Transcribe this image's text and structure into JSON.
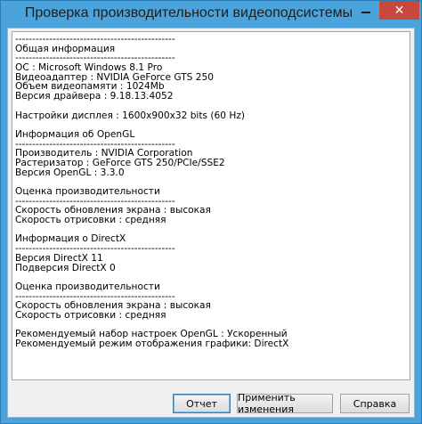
{
  "window": {
    "title": "Проверка производительности видеоподсистемы",
    "close_glyph": "✕"
  },
  "report_lines": [
    "-----------------------------------------------",
    "Общая информация",
    "-----------------------------------------------",
    "ОС : Microsoft Windows 8.1 Pro",
    "Видеоадаптер : NVIDIA GeForce GTS 250",
    "Объем видеопамяти : 1024Mb",
    "Версия драйвера : 9.18.13.4052",
    "",
    "Настройки дисплея : 1600x900x32 bits (60 Hz)",
    "",
    "Информация об OpenGL",
    "-----------------------------------------------",
    "Производитель : NVIDIA Corporation",
    "Растеризатор : GeForce GTS 250/PCIe/SSE2",
    "Версия OpenGL : 3.3.0",
    "",
    "Оценка производительности",
    "-----------------------------------------------",
    "Скорость обновления экрана : высокая",
    "Скорость отрисовки : средняя",
    "",
    "Информация о DirectX",
    "-----------------------------------------------",
    "Версия DirectX 11",
    "Подверсия DirectX 0",
    "",
    "Оценка производительности",
    "-----------------------------------------------",
    "Скорость обновления экрана : высокая",
    "Скорость отрисовки : средняя",
    "",
    "Рекомендуемый набор настроек OpenGL : Ускоренный",
    "Рекомендуемый режим отображения графики: DirectX"
  ],
  "buttons": {
    "report": "Отчет",
    "apply": "Применить изменения",
    "help": "Справка"
  }
}
